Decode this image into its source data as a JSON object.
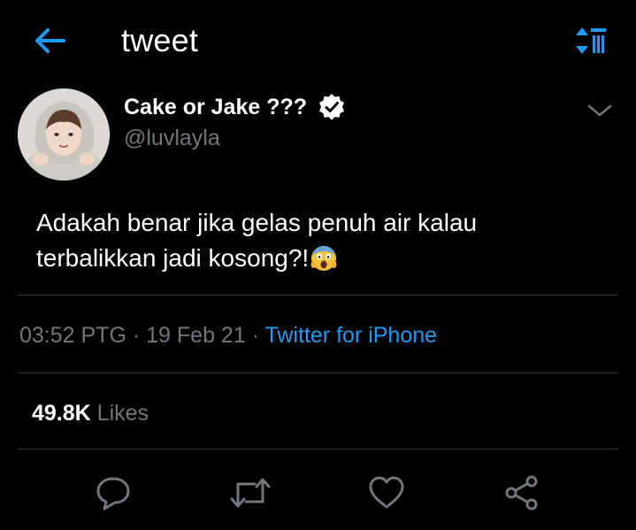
{
  "header": {
    "title": "tweet",
    "back_icon": "back-arrow-icon",
    "sort_icon": "sort-icon"
  },
  "tweet": {
    "author": {
      "display_name": "Cake or Jake ???",
      "handle": "@luvlayla",
      "verified": true
    },
    "text": "Adakah benar jika gelas penuh air kalau terbalikkan jadi kosong?!",
    "emoji": "face-screaming-in-fear",
    "time": "03:52 PTG",
    "separator": "·",
    "date": "19 Feb 21",
    "source": "Twitter for iPhone",
    "likes": {
      "count": "49.8K",
      "label": "Likes"
    }
  },
  "actions": [
    "reply-icon",
    "retweet-icon",
    "like-icon",
    "share-icon"
  ],
  "colors": {
    "background": "#000000",
    "accent": "#1d9bf0",
    "secondary_text": "#71767b",
    "divider": "#2f3336"
  }
}
